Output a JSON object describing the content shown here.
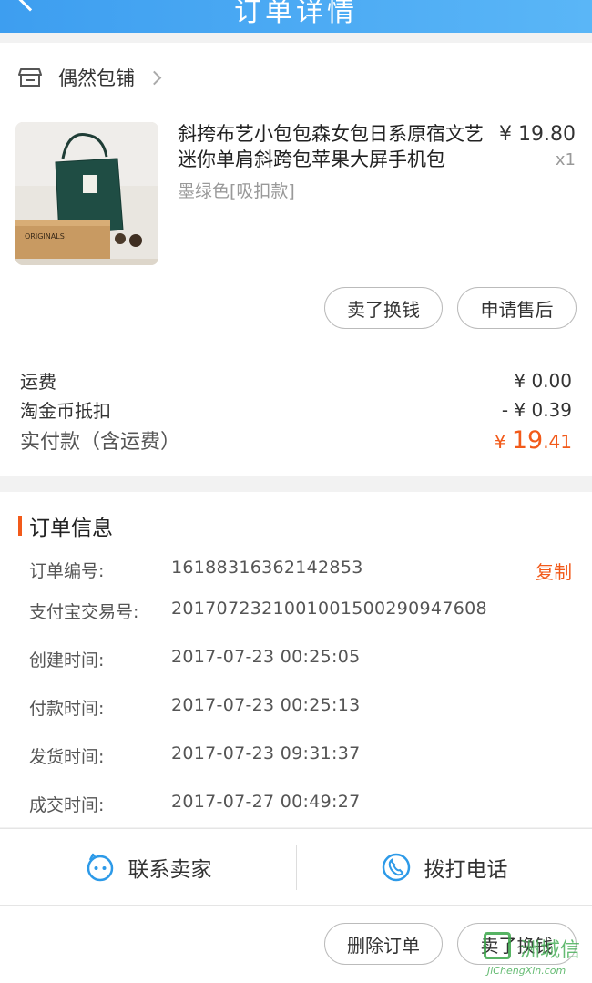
{
  "header": {
    "title": "订单详情"
  },
  "shop": {
    "name": "偶然包铺"
  },
  "product": {
    "title": "斜挎布艺小包包森女包日系原宿文艺迷你单肩斜跨包苹果大屏手机包",
    "sku": "墨绿色[吸扣款]",
    "price": "¥ 19.80",
    "qty": "x1",
    "image_label": "ORIGINALS"
  },
  "actions_top": {
    "sell": "卖了换钱",
    "after_sale": "申请售后"
  },
  "fees": {
    "shipping_label": "运费",
    "shipping_value": "¥ 0.00",
    "coin_label": "淘金币抵扣",
    "coin_value": "- ¥ 0.39",
    "paid_label": "实付款（含运费）",
    "paid_currency": "¥ ",
    "paid_int": "19",
    "paid_dec": ".41"
  },
  "order_info": {
    "title": "订单信息",
    "copy_label": "复制",
    "rows": [
      {
        "key": "订单编号:",
        "value": "16188316362142853"
      },
      {
        "key": "支付宝交易号:",
        "value": "2017072321001001500290947608"
      },
      {
        "key": "创建时间:",
        "value": "2017-07-23 00:25:05"
      },
      {
        "key": "付款时间:",
        "value": "2017-07-23 00:25:13"
      },
      {
        "key": "发货时间:",
        "value": "2017-07-23 09:31:37"
      },
      {
        "key": "成交时间:",
        "value": "2017-07-27 00:49:27"
      }
    ]
  },
  "contact": {
    "seller": "联系卖家",
    "call": "拨打电话"
  },
  "actions_bottom": {
    "delete": "删除订单",
    "sell": "卖了换钱"
  },
  "watermark": {
    "text": "洲城信",
    "url": "JiChengXin.com"
  },
  "colors": {
    "accent": "#f25a1a",
    "header": "#4aa9f3",
    "icon_blue": "#2d9ae8"
  }
}
